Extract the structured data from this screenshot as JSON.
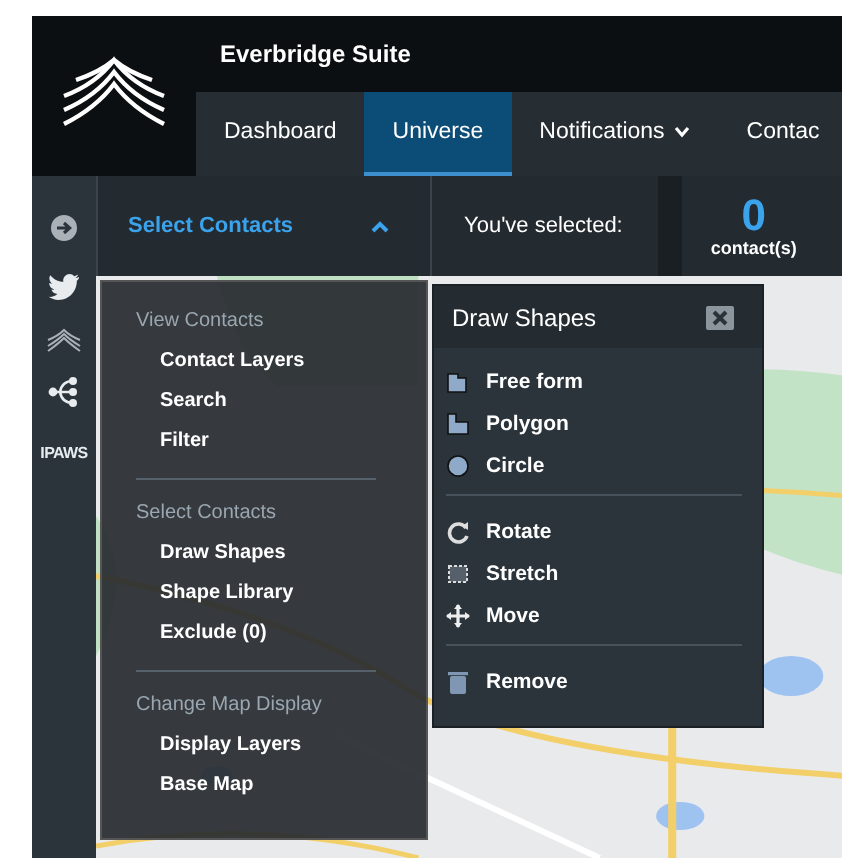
{
  "app": {
    "title": "Everbridge Suite"
  },
  "nav_tabs": [
    {
      "label": "Dashboard",
      "selected": false,
      "has_dropdown": false
    },
    {
      "label": "Universe",
      "selected": true,
      "has_dropdown": false
    },
    {
      "label": "Notifications",
      "selected": false,
      "has_dropdown": true
    },
    {
      "label": "Contac",
      "selected": false,
      "has_dropdown": false
    }
  ],
  "side_rail": {
    "ipaws_label": "IPAWS"
  },
  "contacts_bar": {
    "title": "Select Contacts",
    "expanded": true,
    "selected_label": "You've selected:",
    "count": "0",
    "count_unit": "contact(s)"
  },
  "menu": {
    "sections": [
      {
        "heading": "View Contacts",
        "items": [
          "Contact Layers",
          "Search",
          "Filter"
        ]
      },
      {
        "heading": "Select Contacts",
        "items": [
          "Draw Shapes",
          "Shape Library",
          "Exclude (0)"
        ]
      },
      {
        "heading": "Change Map Display",
        "items": [
          "Display Layers",
          "Base Map"
        ]
      }
    ]
  },
  "draw_shapes": {
    "title": "Draw Shapes",
    "groups": [
      [
        {
          "label": "Free form",
          "kind": "freeform"
        },
        {
          "label": "Polygon",
          "kind": "polygon"
        },
        {
          "label": "Circle",
          "kind": "circle"
        }
      ],
      [
        {
          "label": "Rotate",
          "kind": "rotate"
        },
        {
          "label": "Stretch",
          "kind": "stretch"
        },
        {
          "label": "Move",
          "kind": "move"
        }
      ],
      [
        {
          "label": "Remove",
          "kind": "remove"
        }
      ]
    ]
  }
}
